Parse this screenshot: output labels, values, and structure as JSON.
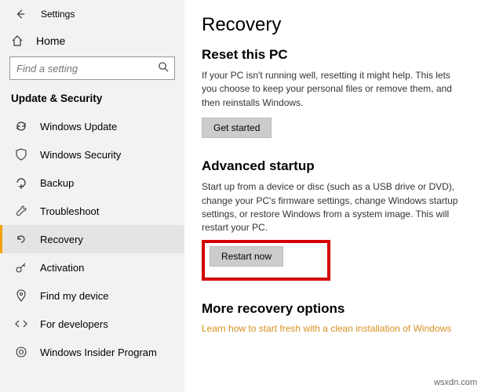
{
  "titlebar": {
    "title": "Settings"
  },
  "sidebar": {
    "home": "Home",
    "search_placeholder": "Find a setting",
    "category": "Update & Security",
    "items": [
      {
        "label": "Windows Update"
      },
      {
        "label": "Windows Security"
      },
      {
        "label": "Backup"
      },
      {
        "label": "Troubleshoot"
      },
      {
        "label": "Recovery"
      },
      {
        "label": "Activation"
      },
      {
        "label": "Find my device"
      },
      {
        "label": "For developers"
      },
      {
        "label": "Windows Insider Program"
      }
    ]
  },
  "main": {
    "heading": "Recovery",
    "reset": {
      "title": "Reset this PC",
      "desc": "If your PC isn't running well, resetting it might help. This lets you choose to keep your personal files or remove them, and then reinstalls Windows.",
      "button": "Get started"
    },
    "advanced": {
      "title": "Advanced startup",
      "desc": "Start up from a device or disc (such as a USB drive or DVD), change your PC's firmware settings, change Windows startup settings, or restore Windows from a system image. This will restart your PC.",
      "button": "Restart now"
    },
    "more": {
      "title": "More recovery options",
      "link": "Learn how to start fresh with a clean installation of Windows"
    }
  },
  "watermark": "wsxdn.com"
}
